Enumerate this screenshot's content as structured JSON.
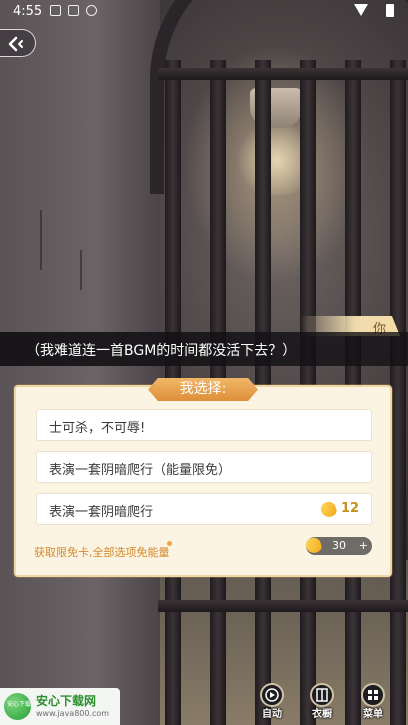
{
  "status_bar": {
    "time": "4:55"
  },
  "dialogue": {
    "speaker": "你",
    "text": "（我难道连一首BGM的时间都没活下去？）"
  },
  "choice_panel": {
    "title": "我选择:",
    "options": [
      {
        "label": "士可杀，不可辱!"
      },
      {
        "label": "表演一套阴暗爬行（能量限免）"
      },
      {
        "label": "表演一套阴暗爬行",
        "cost": "12"
      }
    ],
    "free_card_link": "获取限免卡,全部选项免能量",
    "energy_balance": "30",
    "plus_symbol": "+"
  },
  "bottom_menu": {
    "auto": "自动",
    "wardrobe": "衣橱",
    "menu": "菜单"
  },
  "watermark": {
    "logo_text": "安心下载",
    "title": "安心下载网",
    "url": "www.java800.com"
  },
  "colors": {
    "accent_orange": "#de8e38",
    "panel_bg": "#fbf4e3",
    "coin_gold": "#f2a81b"
  }
}
